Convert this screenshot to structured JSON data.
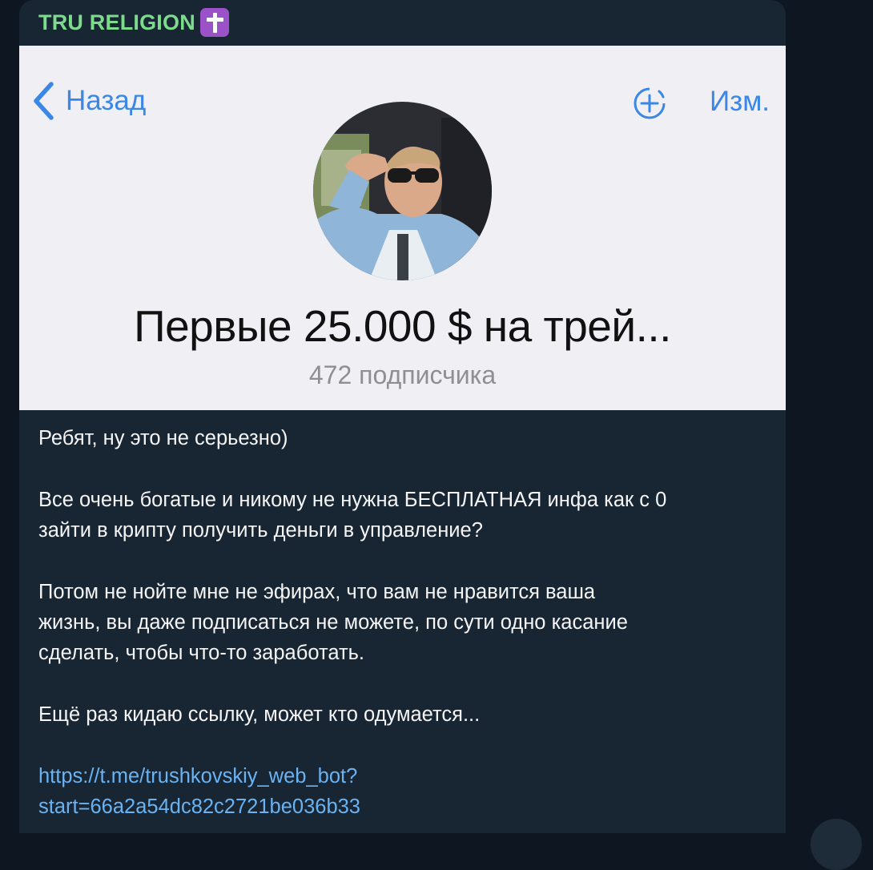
{
  "message": {
    "sender": "TRU RELIGION",
    "sender_emoji_icon": "latin-cross-icon",
    "colors": {
      "chat_bg": "#0e1621",
      "bubble_bg": "#182533",
      "sender": "#7ddc8c",
      "link": "#6ab3f3",
      "text": "#f5f5f5"
    }
  },
  "screenshot": {
    "back_label": "Назад",
    "edit_label": "Изм.",
    "add_icon": "add-member-icon",
    "channel_title": "Первые 25.000 $ на трей...",
    "subscribers": "472 подписчика",
    "accent_color": "#3a87e6"
  },
  "text": {
    "p1": "Ребят, ну это не серьезно)",
    "p2": "Все очень богатые и никому не нужна БЕСПЛАТНАЯ инфа как с 0\nзайти в крипту получить деньги в управление?",
    "p3": "Потом не нойте мне не эфирах, что вам не нравится ваша\nжизнь, вы даже подписаться не можете, по сути одно касание\nсделать, чтобы что-то заработать.",
    "p4": "Ещё раз кидаю ссылку, может кто одумается...",
    "link": "https://t.me/trushkovskiy_web_bot?\nstart=66a2a54dc82c2721be036b33"
  }
}
